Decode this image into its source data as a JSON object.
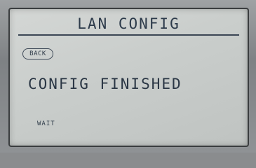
{
  "screen": {
    "title": "LAN CONFIG",
    "back_label": "BACK",
    "message": "CONFIG FINISHED",
    "status": "WAIT"
  }
}
